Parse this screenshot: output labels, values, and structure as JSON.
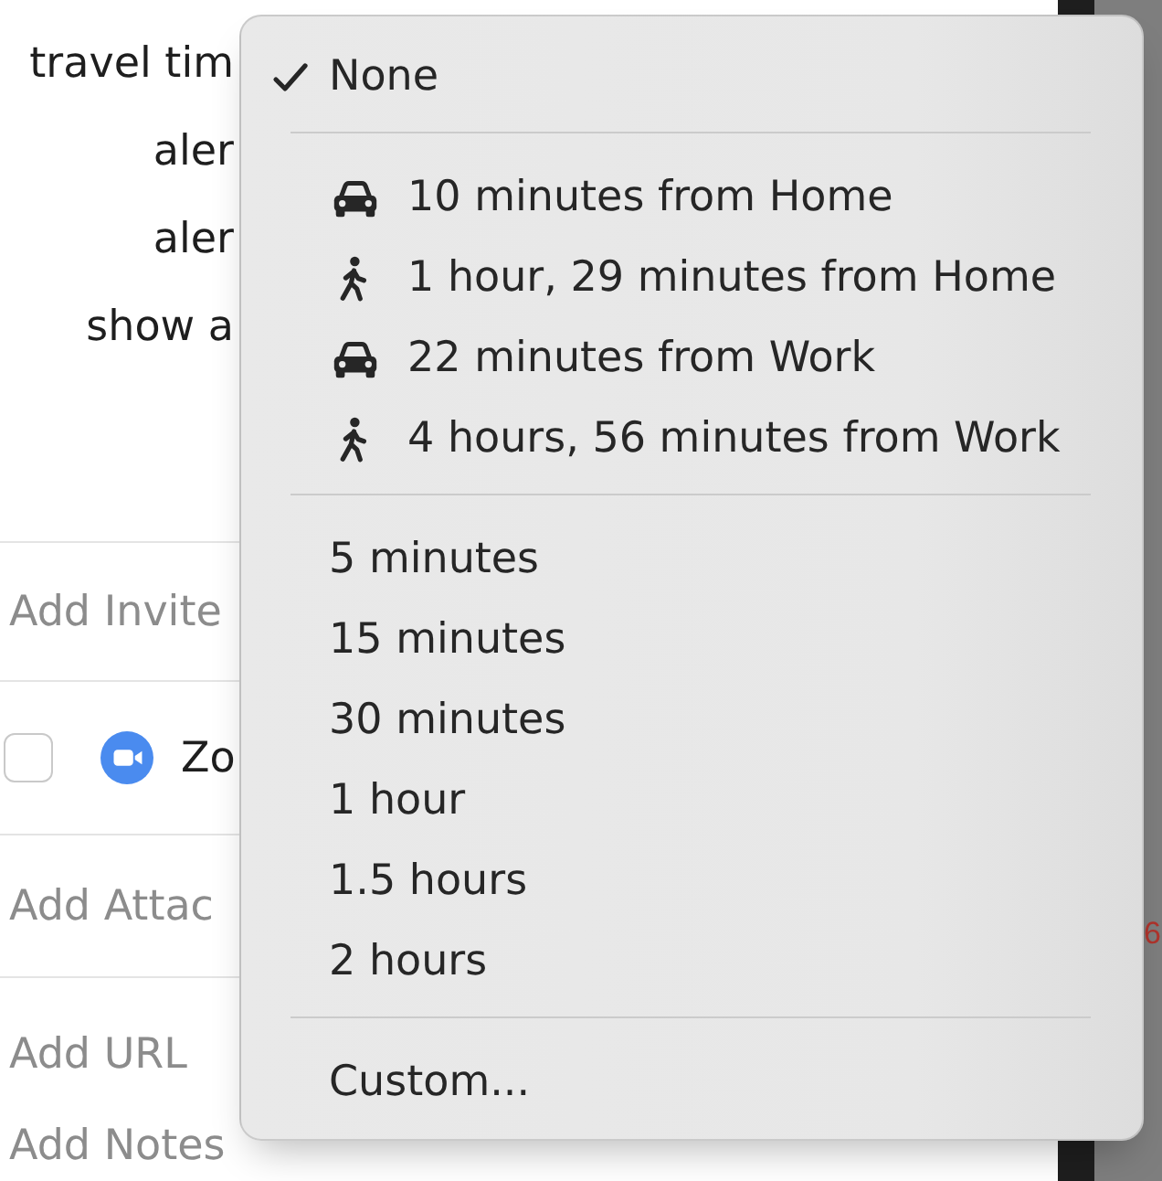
{
  "form": {
    "fields": [
      {
        "label": "travel tim"
      },
      {
        "label": "aler"
      },
      {
        "label": "aler"
      },
      {
        "label": "show a"
      }
    ],
    "invitees": {
      "placeholder": "Add Invite"
    },
    "conference": {
      "checked": false,
      "name": "Zo"
    },
    "attachments": {
      "placeholder": "Add Attac"
    },
    "url": {
      "placeholder": "Add URL"
    },
    "notes": {
      "placeholder": "Add Notes"
    }
  },
  "travel_time_menu": {
    "sections": [
      {
        "items": [
          {
            "kind": "plain",
            "label": "None",
            "selected": true
          }
        ]
      },
      {
        "items": [
          {
            "kind": "drive",
            "label": "10 minutes from Home",
            "selected": false
          },
          {
            "kind": "walk",
            "label": "1 hour, 29 minutes from Home",
            "selected": false
          },
          {
            "kind": "drive",
            "label": "22 minutes from Work",
            "selected": false
          },
          {
            "kind": "walk",
            "label": "4 hours, 56 minutes from Work",
            "selected": false
          }
        ]
      },
      {
        "items": [
          {
            "kind": "plain",
            "label": "5 minutes",
            "selected": false
          },
          {
            "kind": "plain",
            "label": "15 minutes",
            "selected": false
          },
          {
            "kind": "plain",
            "label": "30 minutes",
            "selected": false
          },
          {
            "kind": "plain",
            "label": "1 hour",
            "selected": false
          },
          {
            "kind": "plain",
            "label": "1.5 hours",
            "selected": false
          },
          {
            "kind": "plain",
            "label": "2 hours",
            "selected": false
          }
        ]
      },
      {
        "items": [
          {
            "kind": "plain",
            "label": "Custom...",
            "selected": false
          }
        ]
      }
    ]
  },
  "background_window": {
    "text": "6"
  }
}
